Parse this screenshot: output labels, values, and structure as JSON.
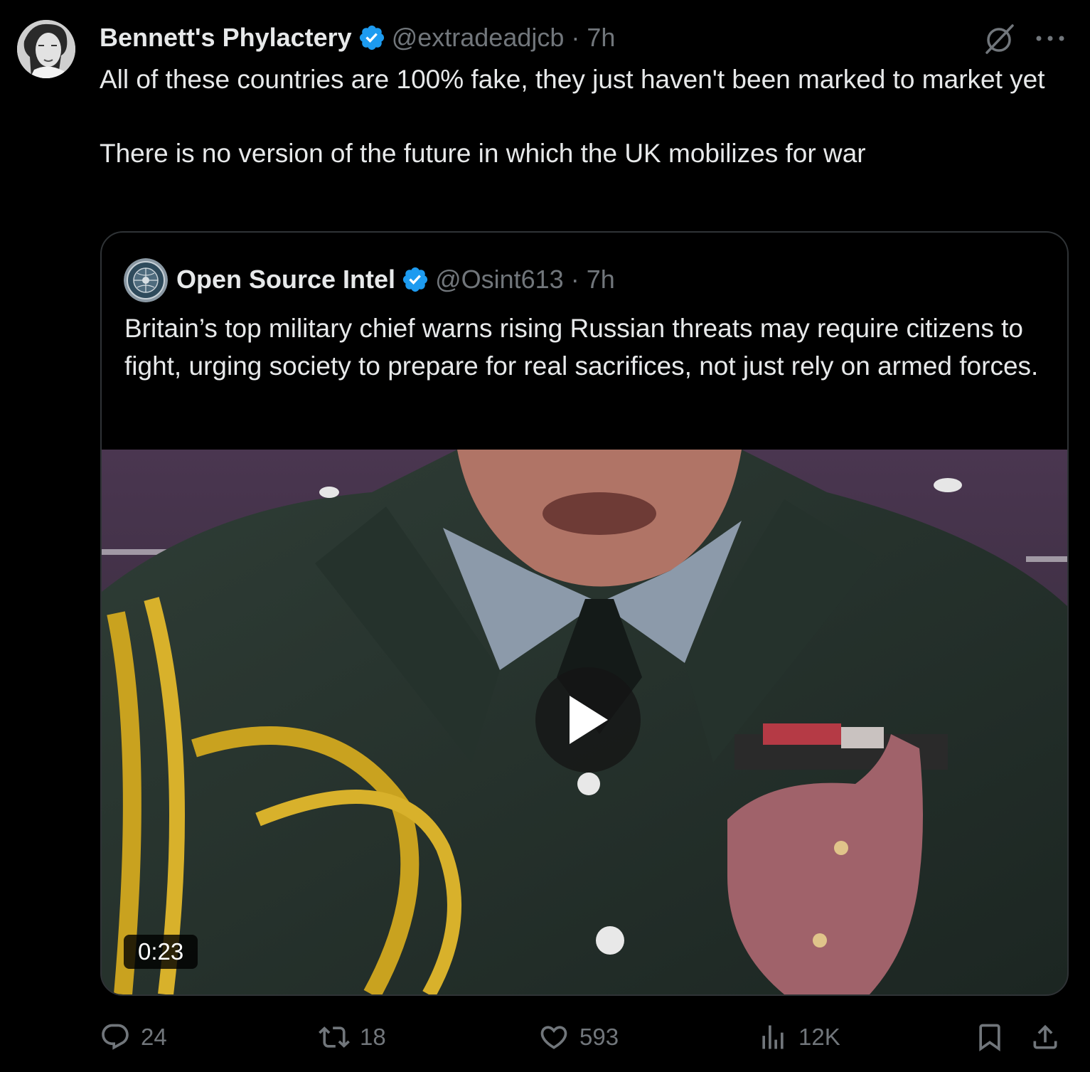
{
  "tweet": {
    "author": {
      "display_name": "Bennett's Phylactery",
      "handle": "@extradeadjcb",
      "time": "7h",
      "verified": true,
      "avatar_icon": "portrait-avatar"
    },
    "separator": "·",
    "text": "All of these countries are 100% fake, they just haven't been marked to market yet\n\nThere is no version of the future in which the UK mobilizes for war",
    "header_icons": [
      "grok-icon",
      "more-icon"
    ]
  },
  "quote": {
    "author": {
      "display_name": "Open Source Intel",
      "handle": "@Osint613",
      "time": "7h",
      "verified": true,
      "avatar_icon": "globe-emblem-avatar"
    },
    "text": "Britain’s top military chief warns rising Russian threats may require citizens to fight, urging society to prepare for real sacrifices, not just rely on armed forces.",
    "video": {
      "duration": "0:23",
      "play_icon": "play-icon"
    }
  },
  "actions": {
    "replies": "24",
    "retweets": "18",
    "likes": "593",
    "views": "12K"
  },
  "colors": {
    "background": "#000000",
    "text": "#e7e9ea",
    "muted": "#71767b",
    "verified": "#1d9bf0",
    "border": "#2f3336"
  }
}
